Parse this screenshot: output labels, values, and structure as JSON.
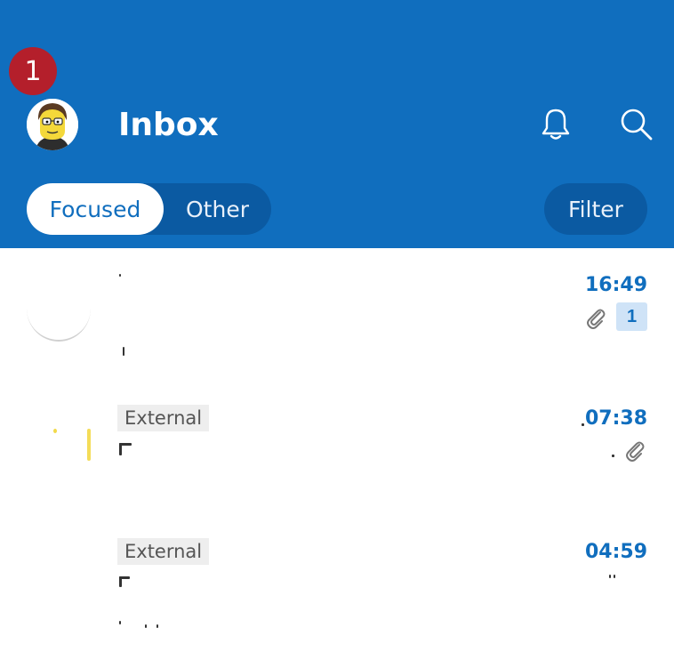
{
  "header": {
    "notification_count": "1",
    "title": "Inbox",
    "tabs": [
      {
        "label": "Focused",
        "selected": true
      },
      {
        "label": "Other",
        "selected": false
      }
    ],
    "filter_label": "Filter",
    "colors": {
      "header_bg": "#106ebe",
      "badge_bg": "#b41f2b"
    },
    "icons": [
      "bell-icon",
      "search-icon"
    ]
  },
  "messages": [
    {
      "time": "16:49",
      "attachment": true,
      "count": "1",
      "external_tag": ""
    },
    {
      "time": "07:38",
      "attachment": true,
      "count": "",
      "external_tag": "External"
    },
    {
      "time": "04:59",
      "attachment": false,
      "count": "",
      "external_tag": "External"
    }
  ]
}
